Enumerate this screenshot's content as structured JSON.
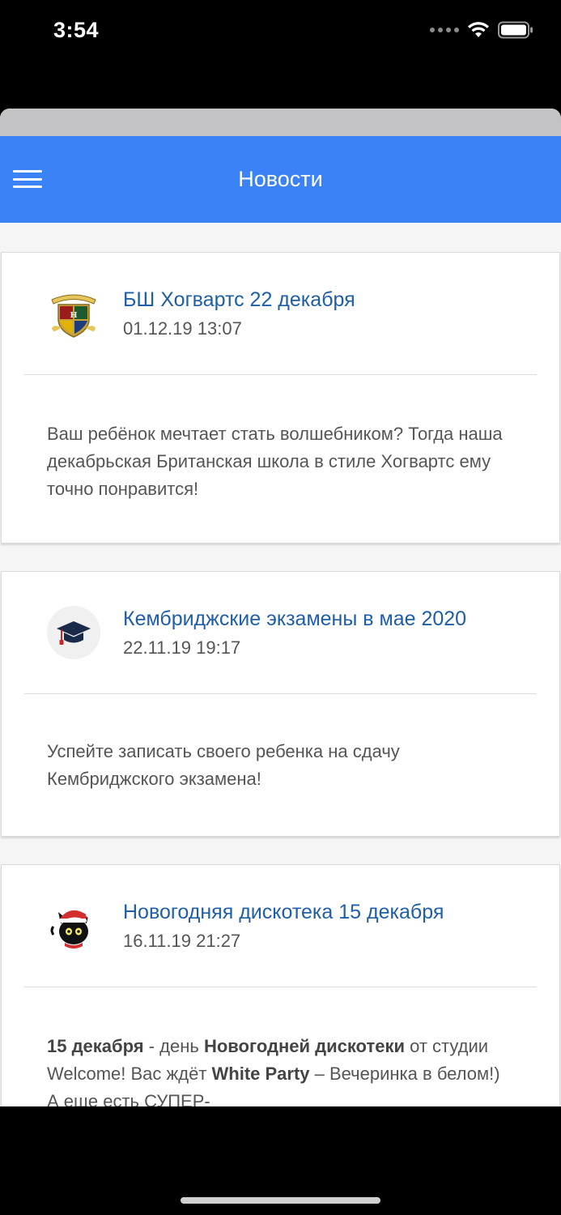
{
  "status_bar": {
    "time": "3:54"
  },
  "header": {
    "title": "Новости"
  },
  "news": [
    {
      "title": "БШ Хогвартс 22 декабря",
      "date": "01.12.19 13:07",
      "avatar": "hogwarts-crest",
      "body": "Ваш ребёнок мечтает стать волшебником? Тогда наша декабрьская Британская школа в стиле Хогвартс ему точно понравится!"
    },
    {
      "title": "Кембриджские экзамены в мае 2020",
      "date": "22.11.19 19:17",
      "avatar": "graduation-cap",
      "body": "Успейте записать своего ребенка на сдачу Кембриджского экзамена!"
    },
    {
      "title": "Новогодняя дискотека 15 декабря",
      "date": "16.11.19 21:27",
      "avatar": "santa-cat",
      "body_parts": {
        "b1": "15 декабря",
        "t1": " - день ",
        "b2": "Новогодней дискотеки",
        "t2": " от студии Welcome! Вас ждёт ",
        "b3": "White Party",
        "t3": " – Вечеринка в белом!) А еще есть СУПЕР-"
      }
    }
  ]
}
